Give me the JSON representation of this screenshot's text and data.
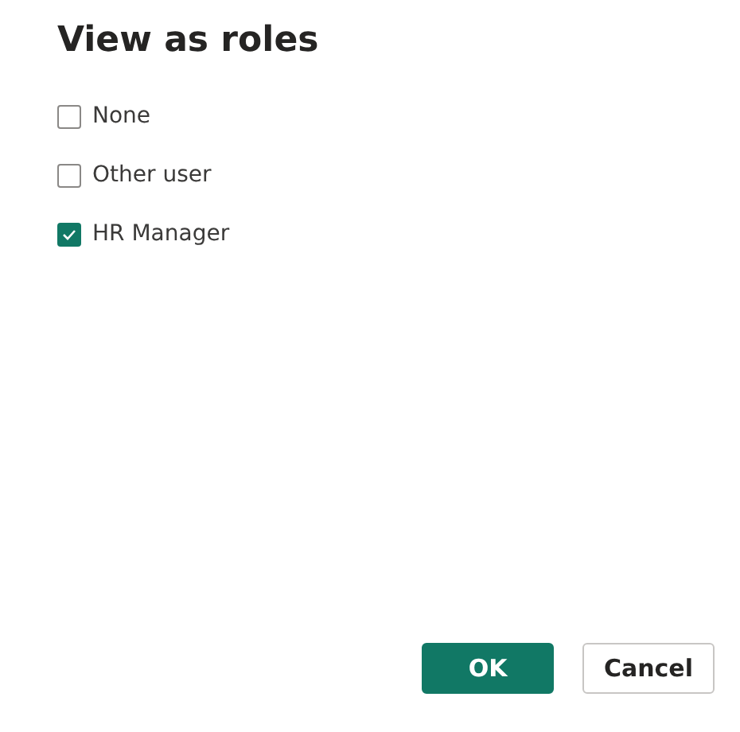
{
  "dialog": {
    "title": "View as roles"
  },
  "roles": [
    {
      "label": "None",
      "checked": false
    },
    {
      "label": "Other user",
      "checked": false
    },
    {
      "label": "HR Manager",
      "checked": true
    }
  ],
  "buttons": [
    {
      "label": "OK",
      "kind": "primary"
    },
    {
      "label": "Cancel",
      "kind": "secondary"
    }
  ]
}
